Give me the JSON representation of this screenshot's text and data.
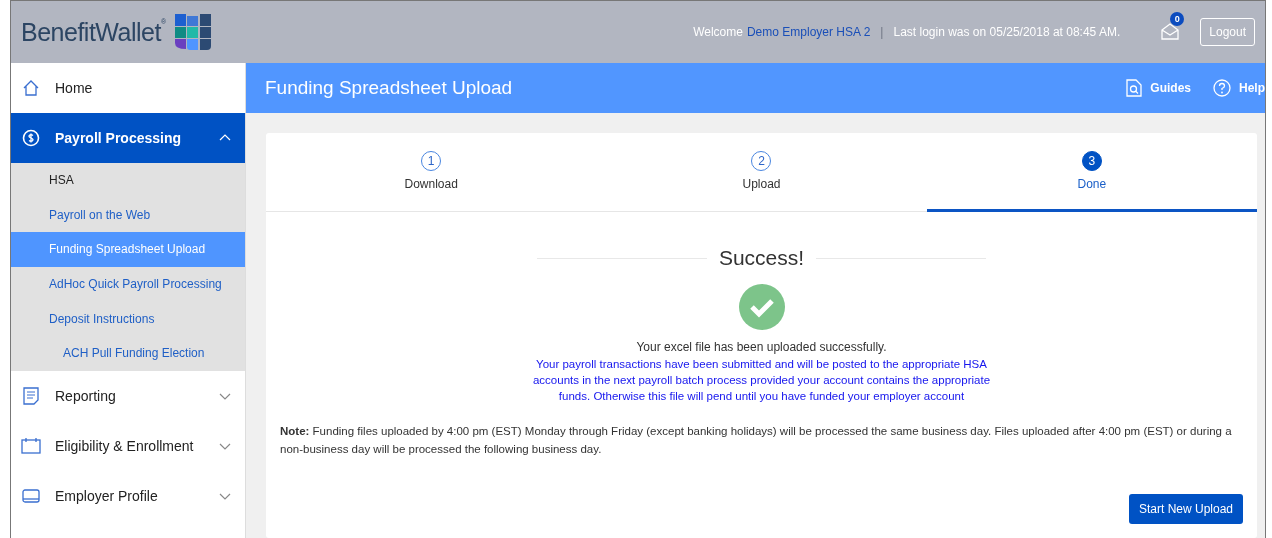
{
  "header": {
    "brand": "BenefitWallet",
    "brand_mark": "®",
    "welcome": "Welcome",
    "user": "Demo Employer HSA 2",
    "separator": "|",
    "last_login": "Last login was on 05/25/2018 at 08:45 AM.",
    "messages_count": "0",
    "logout": "Logout"
  },
  "sidebar": {
    "items": [
      {
        "label": "Home",
        "selected": false
      },
      {
        "label": "Payroll Processing",
        "expanded": true,
        "selected": true,
        "children": [
          {
            "label": "HSA",
            "kind": "label",
            "selected": false
          },
          {
            "label": "Payroll on the Web",
            "kind": "link",
            "selected": false
          },
          {
            "label": "Funding Spreadsheet Upload",
            "kind": "link",
            "selected": true
          },
          {
            "label": "AdHoc Quick Payroll Processing",
            "kind": "link",
            "selected": false
          },
          {
            "label": "Deposit Instructions",
            "kind": "link",
            "selected": false,
            "children": [
              {
                "label": "ACH Pull Funding Election",
                "kind": "link",
                "selected": false
              }
            ]
          }
        ]
      },
      {
        "label": "Reporting",
        "expanded": false,
        "selected": false
      },
      {
        "label": "Eligibility & Enrollment",
        "expanded": false,
        "selected": false
      },
      {
        "label": "Employer Profile",
        "expanded": false,
        "selected": false
      }
    ]
  },
  "page": {
    "title": "Funding Spreadsheet Upload",
    "actions": [
      "Guides",
      "Help"
    ]
  },
  "steps": [
    {
      "number": "1",
      "label": "Download",
      "selected": false
    },
    {
      "number": "2",
      "label": "Upload",
      "selected": false
    },
    {
      "number": "3",
      "label": "Done",
      "selected": true
    }
  ],
  "result": {
    "heading": "Success!",
    "message": "Your excel file has been uploaded successfully.",
    "details": "Your payroll transactions have been submitted and will be posted to the appropriate HSA accounts in the next payroll batch process provided your account contains the appropriate funds. Otherwise this file will pend until you have funded your employer account",
    "note": "**Note:** Funding files uploaded by 4:00 pm (EST) Monday through Friday (except banking holidays) will be processed the same business day. Files uploaded after 4:00 pm (EST) or during a non-business day will be processed the following business day.",
    "button": "Start New Upload"
  }
}
